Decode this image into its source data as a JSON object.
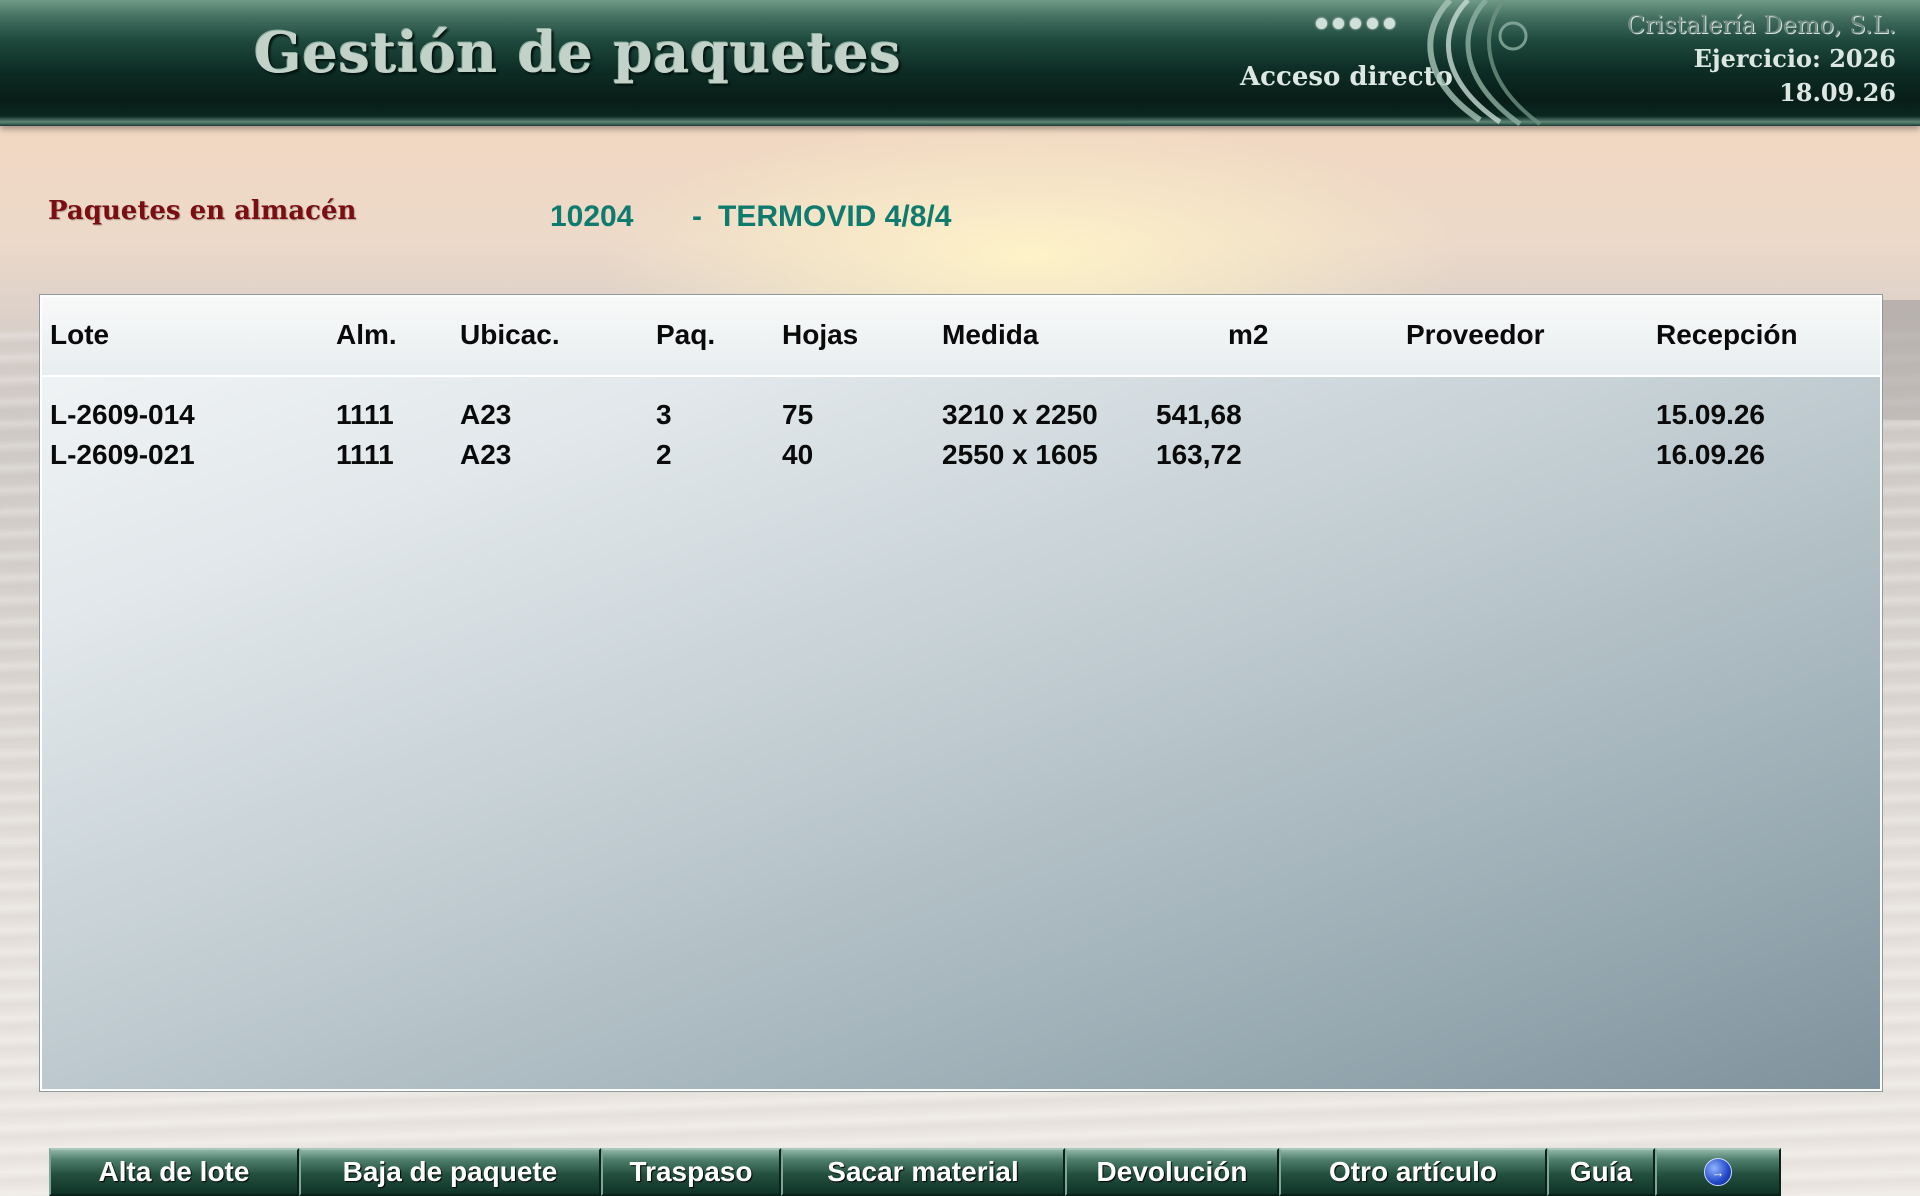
{
  "header": {
    "title": "Gestión de paquetes",
    "shortcut": "Acceso directo",
    "company": "Cristalería Demo, S.L.",
    "fiscal_year": "Ejercicio: 2026",
    "date": "18.09.26"
  },
  "section": {
    "title": "Paquetes en almacén",
    "article_code": "10204",
    "article_dash": "-",
    "article_name": "TERMOVID 4/8/4"
  },
  "table": {
    "columns": {
      "lote": "Lote",
      "alm": "Alm.",
      "ubicac": "Ubicac.",
      "paq": "Paq.",
      "hojas": "Hojas",
      "medida": "Medida",
      "m2": "m2",
      "proveedor": "Proveedor",
      "recepcion": "Recepción"
    },
    "rows": [
      {
        "lote": "L-2609-014",
        "alm": "1111",
        "ubicac": "A23",
        "paq": "3",
        "hojas": "75",
        "medida": "3210 x 2250",
        "m2": "541,68",
        "proveedor": "",
        "recepcion": "15.09.26"
      },
      {
        "lote": "L-2609-021",
        "alm": "1111",
        "ubicac": "A23",
        "paq": "2",
        "hojas": "40",
        "medida": "2550 x 1605",
        "m2": "163,72",
        "proveedor": "",
        "recepcion": "16.09.26"
      }
    ]
  },
  "toolbar": {
    "alta_lote": "Alta de lote",
    "baja_paquete": "Baja de paquete",
    "traspaso": "Traspaso",
    "sacar_material": "Sacar material",
    "devolucion": "Devolución",
    "otro_articulo": "Otro artículo",
    "guia": "Guía",
    "exit_icon": "exit-icon"
  },
  "colors": {
    "header_dark": "#0d2d25",
    "section_title": "#7a0e12",
    "article": "#0f7a6e",
    "button_green": "#24503f"
  }
}
